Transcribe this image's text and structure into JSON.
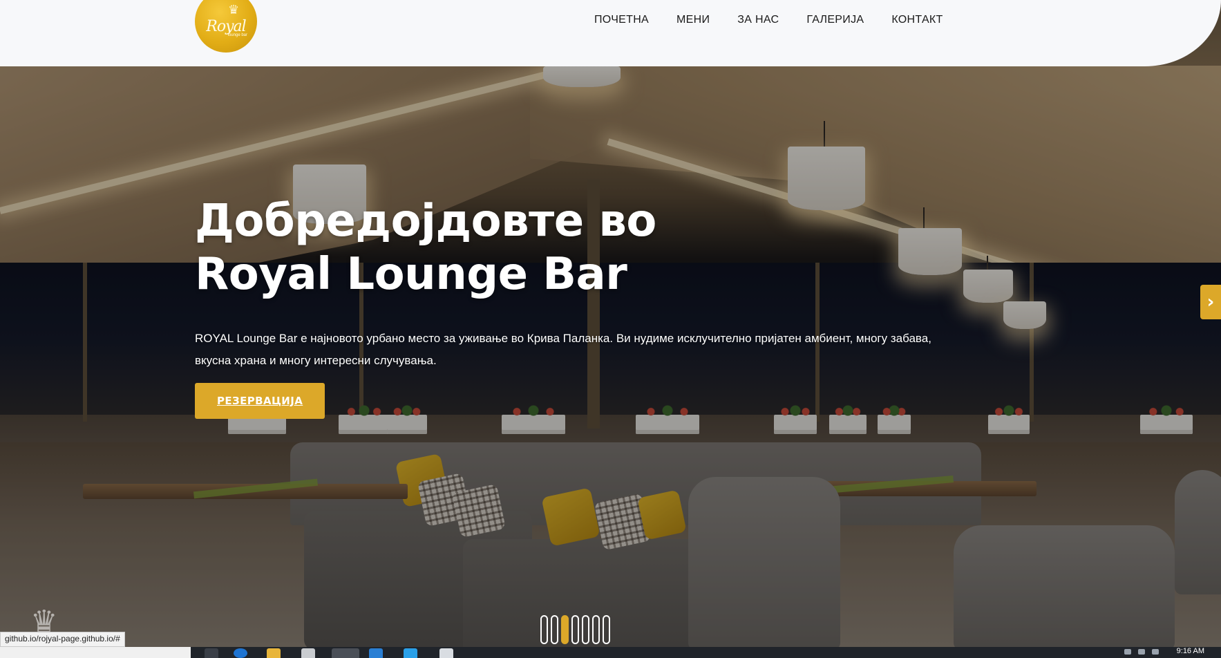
{
  "brand": {
    "logo_text": "Royal",
    "logo_subtext": "lounge bar"
  },
  "nav": {
    "items": [
      {
        "label": "ПОЧЕТНА"
      },
      {
        "label": "МЕНИ"
      },
      {
        "label": "ЗА НАС"
      },
      {
        "label": "ГАЛЕРИЈА"
      },
      {
        "label": "КОНТАКТ"
      }
    ]
  },
  "hero": {
    "title_line1": "Добредојдовте во",
    "title_line2": "Royal Lounge Bar",
    "description": "ROYAL Lounge Bar е најновото урбано место за уживање во Крива Паланка. Ви нудиме исклучително пријатен амбиент, многу забава, вкусна храна и многу интересни случувања.",
    "cta_label": "РЕЗЕРВАЦИЈА",
    "next_arrow_icon": "chevron-right-icon"
  },
  "slider": {
    "slide_count": 7,
    "active_index": 2
  },
  "status_bar": {
    "url": "github.io/rojyal-page.github.io/#"
  },
  "taskbar": {
    "clock": "9:16 AM"
  },
  "colors": {
    "accent": "#dca829",
    "header_bg": "#f7f8fa",
    "nav_text": "#1a1a1a"
  }
}
